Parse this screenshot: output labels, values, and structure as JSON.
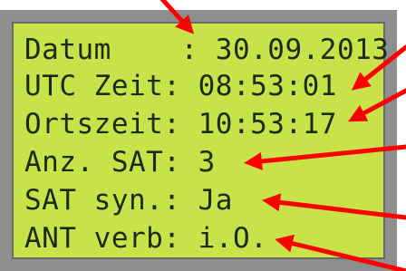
{
  "display": {
    "rows": [
      {
        "label": "Datum    :",
        "value": " 30.09.2013"
      },
      {
        "label": "UTC Zeit:",
        "value": " 08:53:01"
      },
      {
        "label": "Ortszeit:",
        "value": " 10:53:17"
      },
      {
        "label": "Anz. SAT:",
        "value": " 3"
      },
      {
        "label": "SAT syn.:",
        "value": " Ja"
      },
      {
        "label": "ANT verb:",
        "value": " i.O."
      }
    ]
  },
  "colors": {
    "lcd_background": "#c8e24a",
    "lcd_text": "#1f2a12",
    "bezel": "#8e8e8e",
    "arrow": "#ff0000"
  }
}
